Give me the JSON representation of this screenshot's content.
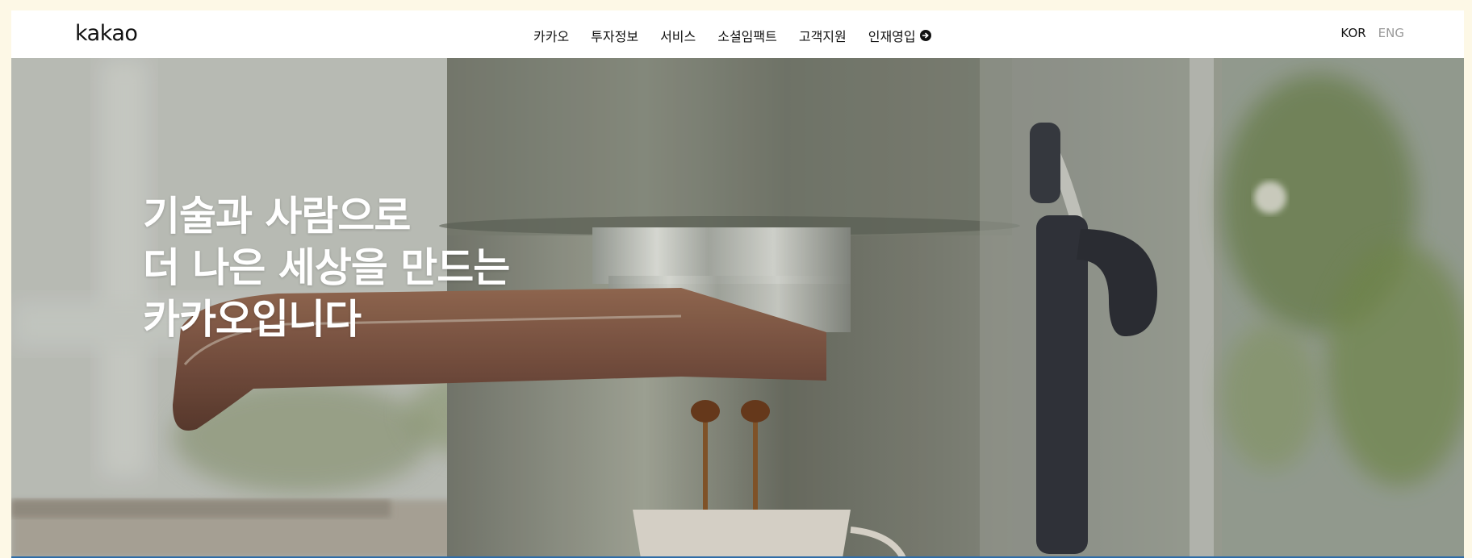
{
  "header": {
    "logo": "kakao",
    "nav": [
      {
        "label": "카카오"
      },
      {
        "label": "투자정보"
      },
      {
        "label": "서비스"
      },
      {
        "label": "소셜임팩트"
      },
      {
        "label": "고객지원"
      },
      {
        "label": "인재영입",
        "icon": "arrow-circle-right-icon"
      }
    ],
    "lang": {
      "kor": "KOR",
      "eng": "ENG"
    }
  },
  "hero": {
    "lines": [
      "기술과 사람으로",
      "더 나은 세상을 만드는",
      "카카오입니다"
    ],
    "image": "espresso-machine-pouring-coffee"
  },
  "colors": {
    "page_bg": "#fdf8e6",
    "text": "#111111",
    "lang_inactive": "#999999",
    "hero_text": "#ffffff",
    "bottom_accent": "#2f6da8"
  }
}
